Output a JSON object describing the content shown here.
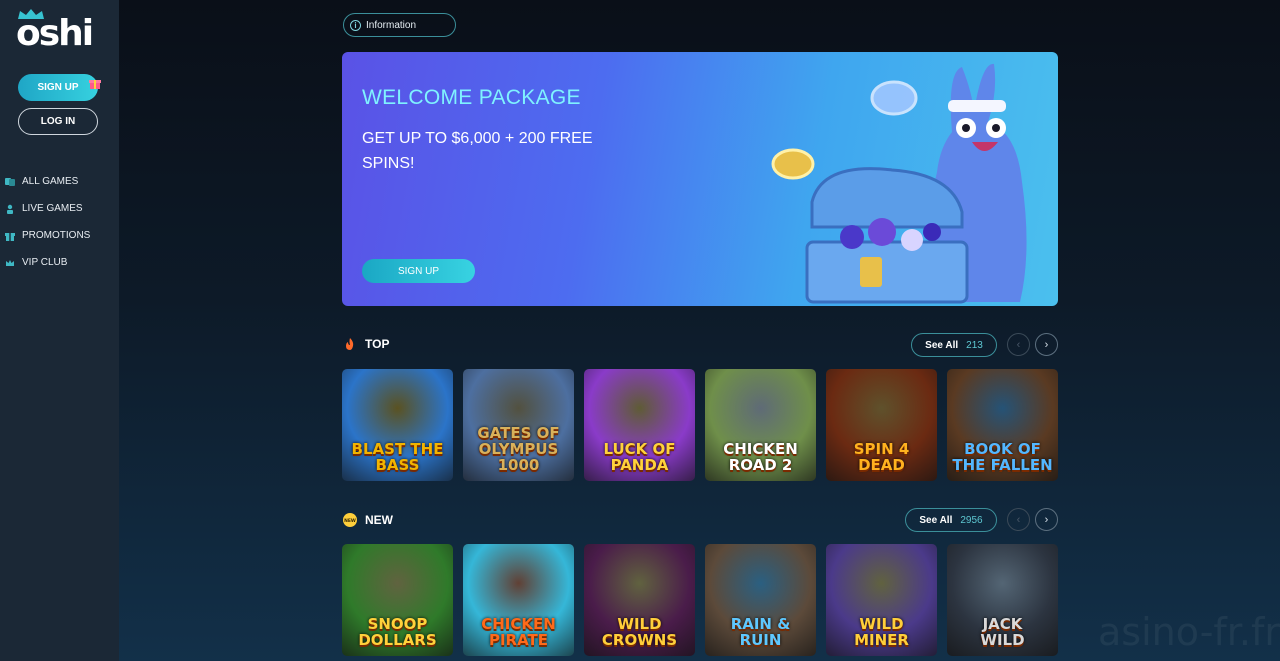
{
  "brand": {
    "logo_text": "oshi"
  },
  "sidebar": {
    "signup_label": "SIGN UP",
    "login_label": "LOG IN",
    "items": [
      {
        "label": "ALL GAMES",
        "icon": "cards-icon"
      },
      {
        "label": "LIVE GAMES",
        "icon": "dealer-icon"
      },
      {
        "label": "PROMOTIONS",
        "icon": "gift-icon"
      },
      {
        "label": "VIP CLUB",
        "icon": "crown-icon"
      }
    ]
  },
  "info": {
    "label": "Information"
  },
  "banner": {
    "title": "WELCOME PACKAGE",
    "subtitle": "GET UP TO $6,000 + 200 FREE SPINS!",
    "button_label": "SIGN UP"
  },
  "sections": {
    "top": {
      "title": "TOP",
      "see_all_label": "See All",
      "count": "213",
      "games": [
        {
          "title": "BLAST THE\nBASS",
          "bg": "#2b74c9",
          "accent": "#f2b400"
        },
        {
          "title": "GATES of OLYMPUS\n1000",
          "bg": "#4d6fa0",
          "accent": "#d9b15a"
        },
        {
          "title": "LUCK of\nPANDA",
          "bg": "#8a3bc9",
          "accent": "#ffd23b"
        },
        {
          "title": "CHICKEN\nROAD 2",
          "bg": "#6f8f4a",
          "accent": "#ffffff"
        },
        {
          "title": "SPIN 4\nDEAD",
          "bg": "#6b2a12",
          "accent": "#ffb21f"
        },
        {
          "title": "BOOK OF\nTHE FALLEN",
          "bg": "#5a3a22",
          "accent": "#53b7ff"
        }
      ]
    },
    "new": {
      "title": "NEW",
      "see_all_label": "See All",
      "count": "2956",
      "games": [
        {
          "title": "SNOOP\nDOLLARS",
          "bg": "#2f7a2a",
          "accent": "#ffd23b"
        },
        {
          "title": "CHICKEN\nPIRATE",
          "bg": "#35b7d8",
          "accent": "#ff6a1a"
        },
        {
          "title": "WILD\nCROWNS",
          "bg": "#4a1c4a",
          "accent": "#ffcf3b"
        },
        {
          "title": "RAIN &\nRUIN",
          "bg": "#5c4a3a",
          "accent": "#5ec8ff"
        },
        {
          "title": "WILD\nMINER",
          "bg": "#4b3a8a",
          "accent": "#ffcf3b"
        },
        {
          "title": "JACK\nWILD",
          "bg": "#2c3440",
          "accent": "#d9d9d9"
        }
      ]
    }
  },
  "watermark": "asino-fr.fr"
}
